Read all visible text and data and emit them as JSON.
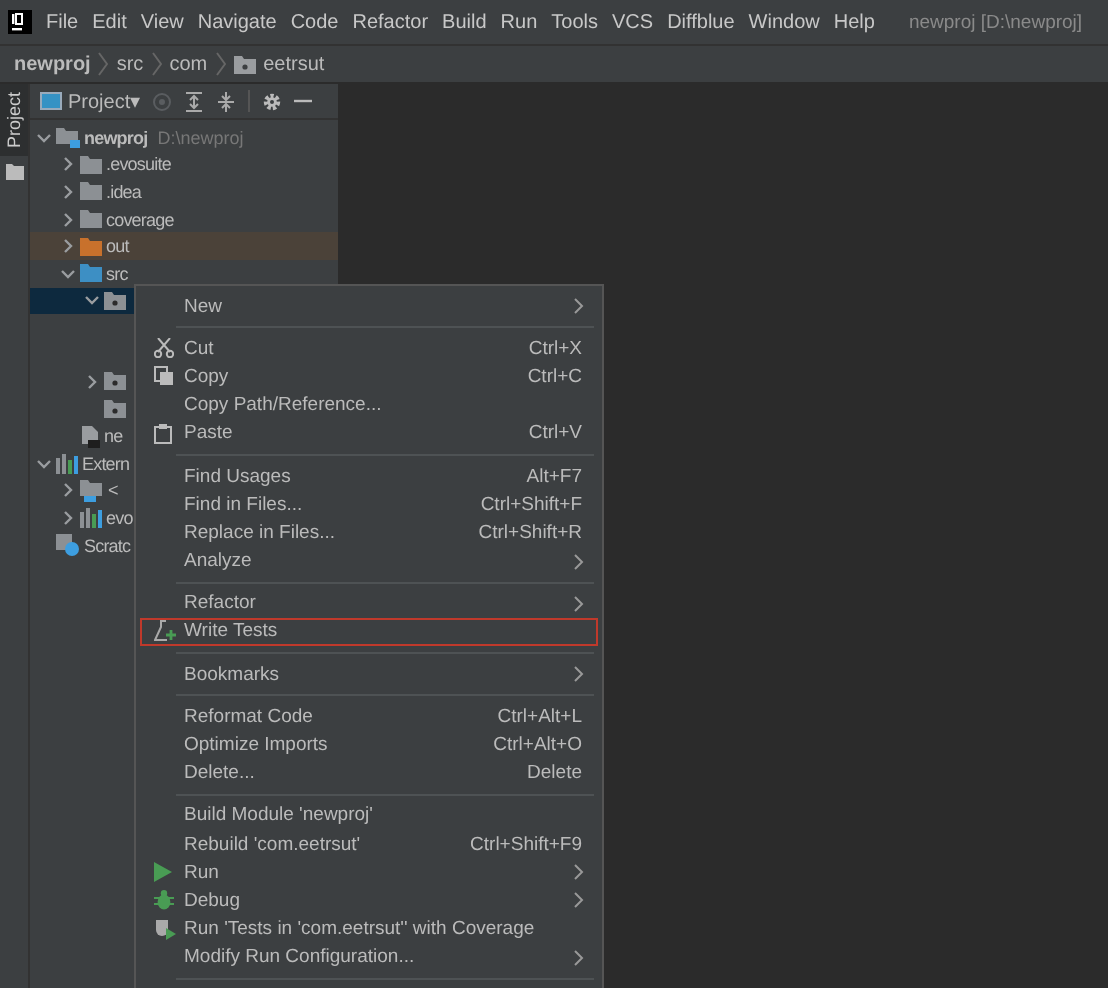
{
  "menubar": {
    "items": [
      "File",
      "Edit",
      "View",
      "Navigate",
      "Code",
      "Refactor",
      "Build",
      "Run",
      "Tools",
      "VCS",
      "Diffblue",
      "Window",
      "Help"
    ],
    "project_title": "newproj [D:\\newproj]"
  },
  "breadcrumbs": [
    {
      "label": "newproj",
      "kind": "project"
    },
    {
      "label": "src",
      "kind": "dir"
    },
    {
      "label": "com",
      "kind": "dir"
    },
    {
      "label": "eetrsut",
      "kind": "package"
    }
  ],
  "side_tab": {
    "label": "Project"
  },
  "panel": {
    "view_selector": "Project▾"
  },
  "tree": [
    {
      "label": "newproj",
      "path": "D:\\newproj",
      "kind": "module",
      "expanded": true,
      "selected": false,
      "excluded": false,
      "children": [
        {
          "label": ".evosuite",
          "kind": "folder",
          "color": "#8c9094",
          "expanded": false,
          "selected": false,
          "excluded": false
        },
        {
          "label": ".idea",
          "kind": "folder",
          "color": "#8c9094",
          "expanded": false,
          "selected": false,
          "excluded": false
        },
        {
          "label": "coverage",
          "kind": "folder",
          "color": "#8c9094",
          "expanded": false,
          "selected": false,
          "excluded": false
        },
        {
          "label": "out",
          "kind": "folder",
          "color": "#c8712c",
          "expanded": false,
          "selected": false,
          "excluded": true
        },
        {
          "label": "src",
          "kind": "folder",
          "color": "#3d8fc4",
          "expanded": true,
          "selected": false,
          "excluded": false,
          "children": [
            {
              "kind": "package",
              "expanded": true,
              "selected": true,
              "excluded": false
            },
            {
              "kind": "package",
              "expanded": false,
              "selected": false,
              "excluded": false
            },
            {
              "kind": "package",
              "selected": false,
              "excluded": false
            }
          ]
        },
        {
          "label": "ne",
          "kind": "file",
          "selected": false,
          "excluded": false
        }
      ]
    },
    {
      "label": "Extern",
      "kind": "library",
      "expanded": true,
      "selected": false,
      "excluded": false,
      "children": [
        {
          "label": "<",
          "kind": "jdk",
          "expanded": false,
          "selected": false,
          "excluded": false
        },
        {
          "label": "evo",
          "kind": "library",
          "expanded": false,
          "selected": false,
          "excluded": false
        }
      ]
    },
    {
      "label": "Scratc",
      "kind": "scratch",
      "selected": false,
      "excluded": false
    }
  ],
  "context_menu": [
    {
      "kind": "item",
      "label": "New",
      "submenu": true,
      "highlighted": false
    },
    {
      "kind": "separator"
    },
    {
      "kind": "item",
      "label": "Cut",
      "shortcut": "Ctrl+X",
      "submenu": false,
      "highlighted": false
    },
    {
      "kind": "item",
      "label": "Copy",
      "shortcut": "Ctrl+C",
      "submenu": false,
      "highlighted": false
    },
    {
      "kind": "item",
      "label": "Copy Path/Reference...",
      "submenu": false,
      "highlighted": false
    },
    {
      "kind": "item",
      "label": "Paste",
      "shortcut": "Ctrl+V",
      "submenu": false,
      "highlighted": false
    },
    {
      "kind": "separator"
    },
    {
      "kind": "item",
      "label": "Find Usages",
      "shortcut": "Alt+F7",
      "submenu": false,
      "highlighted": false
    },
    {
      "kind": "item",
      "label": "Find in Files...",
      "shortcut": "Ctrl+Shift+F",
      "submenu": false,
      "highlighted": false
    },
    {
      "kind": "item",
      "label": "Replace in Files...",
      "shortcut": "Ctrl+Shift+R",
      "submenu": false,
      "highlighted": false
    },
    {
      "kind": "item",
      "label": "Analyze",
      "submenu": true,
      "highlighted": false
    },
    {
      "kind": "separator"
    },
    {
      "kind": "item",
      "label": "Refactor",
      "submenu": true,
      "highlighted": false
    },
    {
      "kind": "item",
      "label": "Write Tests",
      "submenu": false,
      "highlighted": true
    },
    {
      "kind": "separator"
    },
    {
      "kind": "item",
      "label": "Bookmarks",
      "submenu": true,
      "highlighted": false
    },
    {
      "kind": "separator"
    },
    {
      "kind": "item",
      "label": "Reformat Code",
      "shortcut": "Ctrl+Alt+L",
      "submenu": false,
      "highlighted": false
    },
    {
      "kind": "item",
      "label": "Optimize Imports",
      "shortcut": "Ctrl+Alt+O",
      "submenu": false,
      "highlighted": false
    },
    {
      "kind": "item",
      "label": "Delete...",
      "shortcut": "Delete",
      "submenu": false,
      "highlighted": false
    },
    {
      "kind": "separator"
    },
    {
      "kind": "item",
      "label": "Build Module 'newproj'",
      "submenu": false,
      "highlighted": false
    },
    {
      "kind": "item",
      "label": "Rebuild 'com.eetrsut'",
      "shortcut": "Ctrl+Shift+F9",
      "submenu": false,
      "highlighted": false
    },
    {
      "kind": "item",
      "label": "Run",
      "submenu": true,
      "highlighted": false
    },
    {
      "kind": "item",
      "label": "Debug",
      "submenu": true,
      "highlighted": false
    },
    {
      "kind": "item",
      "label": "Run 'Tests in 'com.eetrsut'' with Coverage",
      "submenu": false,
      "highlighted": false
    },
    {
      "kind": "item",
      "label": "Modify Run Configuration...",
      "submenu": true,
      "highlighted": false
    },
    {
      "kind": "separator"
    }
  ]
}
